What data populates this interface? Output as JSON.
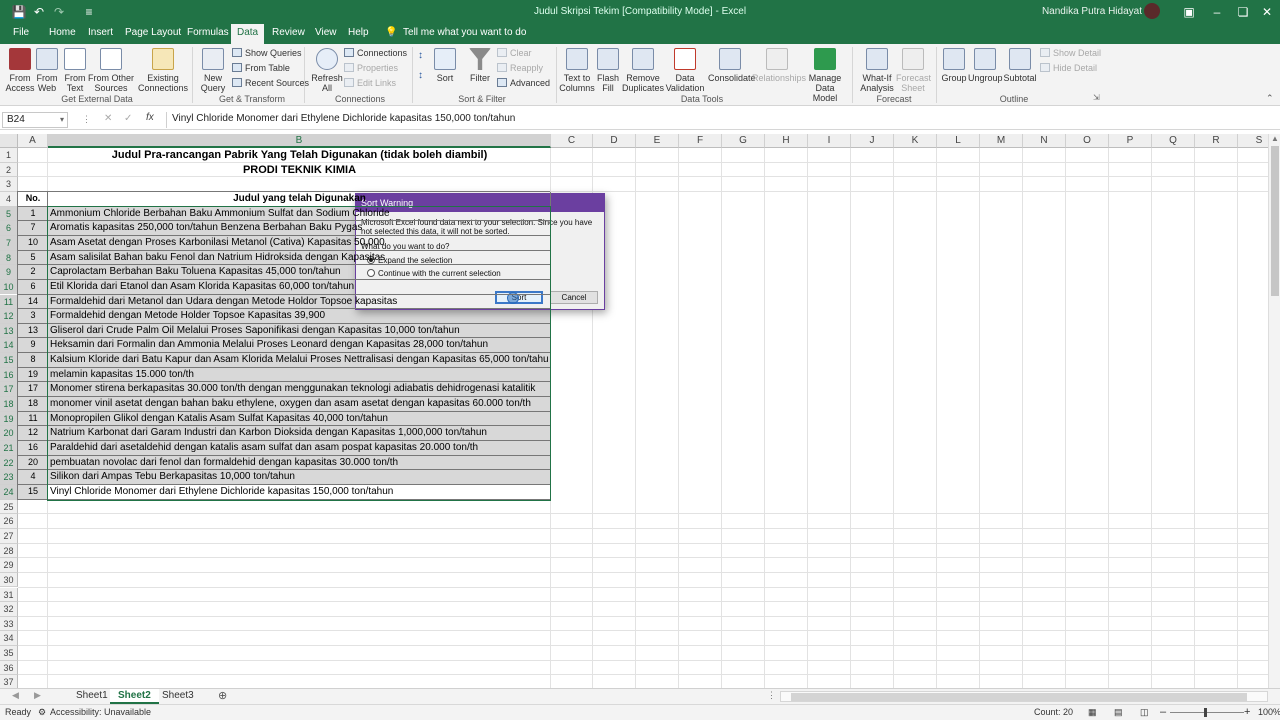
{
  "window": {
    "title": "Judul Skripsi Tekim  [Compatibility Mode]  -  Excel",
    "user": "Nandika Putra Hidayat"
  },
  "tabs": [
    "File",
    "Home",
    "Insert",
    "Page Layout",
    "Formulas",
    "Data",
    "Review",
    "View",
    "Help"
  ],
  "active_tab": "Data",
  "tell_me": "Tell me what you want to do",
  "ribbon": {
    "from_access": "From Access",
    "from_web": "From Web",
    "from_text": "From Text",
    "from_other": "From Other Sources",
    "existing": "Existing Connections",
    "grp_external": "Get External Data",
    "new_query": "New Query",
    "show_queries": "Show Queries",
    "from_table": "From Table",
    "recent_sources": "Recent Sources",
    "grp_transform": "Get & Transform",
    "refresh_all": "Refresh All",
    "connections": "Connections",
    "properties": "Properties",
    "edit_links": "Edit Links",
    "grp_connections": "Connections",
    "sort": "Sort",
    "filter": "Filter",
    "clear": "Clear",
    "reapply": "Reapply",
    "advanced": "Advanced",
    "grp_sortfilter": "Sort & Filter",
    "text_to_columns": "Text to Columns",
    "flash_fill": "Flash Fill",
    "remove_duplicates": "Remove Duplicates",
    "data_validation": "Data Validation",
    "consolidate": "Consolidate",
    "relationships": "Relationships",
    "manage_data_model": "Manage Data Model",
    "grp_datatools": "Data Tools",
    "what_if": "What-If Analysis",
    "forecast_sheet": "Forecast Sheet",
    "grp_forecast": "Forecast",
    "group": "Group",
    "ungroup": "Ungroup",
    "subtotal": "Subtotal",
    "show_detail": "Show Detail",
    "hide_detail": "Hide Detail",
    "grp_outline": "Outline"
  },
  "formula_bar": {
    "name_box": "B24",
    "fx": "fx",
    "formula": "Vinyl Chloride Monomer dari Ethylene Dichloride kapasitas 150,000 ton/tahun"
  },
  "columns": [
    "A",
    "B",
    "C",
    "D",
    "E",
    "F",
    "G",
    "H",
    "I",
    "J",
    "K",
    "L",
    "M",
    "N",
    "O",
    "P",
    "Q",
    "R",
    "S"
  ],
  "sheet": {
    "title1": "Judul Pra-rancangan Pabrik Yang Telah Digunakan (tidak boleh diambil)",
    "title2": "PRODI TEKNIK KIMIA",
    "header_no": "No.",
    "header_judul": "Judul yang telah Digunakan",
    "rows": [
      {
        "no": "1",
        "judul": "Ammonium Chloride Berbahan Baku Ammonium Sulfat dan Sodium Chloride"
      },
      {
        "no": "7",
        "judul": "Aromatis kapasitas 250,000 ton/tahun Benzena Berbahan Baku Pygas"
      },
      {
        "no": "10",
        "judul": "Asam Asetat dengan Proses Karbonilasi Metanol (Cativa) Kapasitas 50,000"
      },
      {
        "no": "5",
        "judul": "Asam salisilat Bahan baku Fenol dan Natrium Hidroksida dengan Kapasitas"
      },
      {
        "no": "2",
        "judul": "Caprolactam Berbahan Baku Toluena Kapasitas 45,000 ton/tahun"
      },
      {
        "no": "6",
        "judul": "Etil Klorida dari Etanol dan Asam Klorida Kapasitas 60,000 ton/tahun"
      },
      {
        "no": "14",
        "judul": "Formaldehid dari Metanol dan Udara dengan Metode Holdor Topsoe kapasitas"
      },
      {
        "no": "3",
        "judul": "Formaldehid dengan Metode Holder Topsoe Kapasitas 39,900"
      },
      {
        "no": "13",
        "judul": "Gliserol dari Crude Palm Oil Melalui Proses Saponifikasi dengan Kapasitas 10,000 ton/tahun"
      },
      {
        "no": "9",
        "judul": "Heksamin dari Formalin dan Ammonia Melalui Proses Leonard dengan Kapasitas 28,000 ton/tahun"
      },
      {
        "no": "8",
        "judul": "Kalsium Kloride dari Batu Kapur dan Asam Klorida Melalui Proses Nettralisasi dengan Kapasitas 65,000 ton/tahun"
      },
      {
        "no": "19",
        "judul": "melamin kapasitas 15.000 ton/th"
      },
      {
        "no": "17",
        "judul": "Monomer stirena berkapasitas 30.000 ton/th dengan menggunakan teknologi adiabatis dehidrogenasi katalitik"
      },
      {
        "no": "18",
        "judul": "monomer vinil asetat  dengan bahan baku ethylene, oxygen dan asam asetat dengan kapasitas 60.000 ton/th"
      },
      {
        "no": "11",
        "judul": "Monopropilen Glikol dengan Katalis Asam Sulfat Kapasitas 40,000 ton/tahun"
      },
      {
        "no": "12",
        "judul": "Natrium Karbonat dari Garam Industri dan Karbon Dioksida dengan Kapasitas 1,000,000 ton/tahun"
      },
      {
        "no": "16",
        "judul": "Paraldehid dari asetaldehid dengan katalis asam sulfat dan asam pospat kapasitas 20.000 ton/th"
      },
      {
        "no": "20",
        "judul": "pembuatan novolac dari fenol dan formaldehid dengan kapasitas 30.000 ton/th"
      },
      {
        "no": "4",
        "judul": "Silikon dari Ampas Tebu Berkapasitas 10,000 ton/tahun"
      },
      {
        "no": "15",
        "judul": "Vinyl Chloride Monomer dari Ethylene Dichloride kapasitas 150,000 ton/tahun"
      }
    ]
  },
  "dialog": {
    "title": "Sort Warning",
    "message": "Microsoft Excel found data next to your selection.  Since you have not selected this data, it will not be sorted.",
    "question": "What do you want to do?",
    "option_expand": "Expand the selection",
    "option_continue": "Continue with the current selection",
    "sort_button": "Sort",
    "cancel_button": "Cancel"
  },
  "sheet_tabs": [
    "Sheet1",
    "Sheet2",
    "Sheet3"
  ],
  "active_sheet": "Sheet2",
  "status": {
    "ready": "Ready",
    "accessibility": "Accessibility: Unavailable",
    "count": "Count: 20",
    "zoom": "100%"
  },
  "colors": {
    "excel_green": "#217346",
    "dialog_title": "#6b3fa0",
    "selection": "#d8d8d8"
  }
}
